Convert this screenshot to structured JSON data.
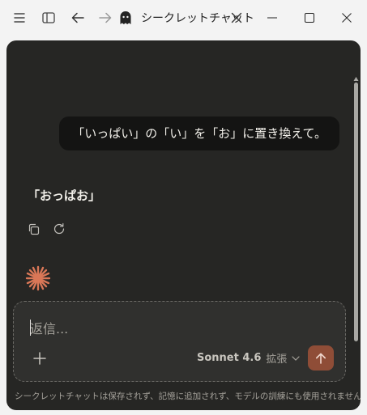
{
  "window": {
    "tab_title": "シークレットチャット",
    "icons": {
      "menu": "hamburger-menu-icon",
      "sidebar": "sidebar-toggle-icon",
      "back": "arrow-left-icon",
      "forward": "arrow-right-icon",
      "ghost": "ghost-icon",
      "close_tab": "close-icon",
      "minimize": "minimize-icon",
      "maximize": "maximize-icon",
      "close_window": "close-window-icon"
    }
  },
  "conversation": {
    "user_message": "「いっぱい」の「い」を「お」に置き換えて。",
    "assistant_message": "「おっぱお」",
    "actions": [
      "copy-icon",
      "retry-icon"
    ]
  },
  "composer": {
    "placeholder": "返信...",
    "model_name": "Sonnet 4.6",
    "model_mode": "拡張",
    "accent_color": "#8f4d37"
  },
  "footer_note": "シークレットチャットは保存されず、記憶に追加されず、モデルの訓練にも使用されません。"
}
